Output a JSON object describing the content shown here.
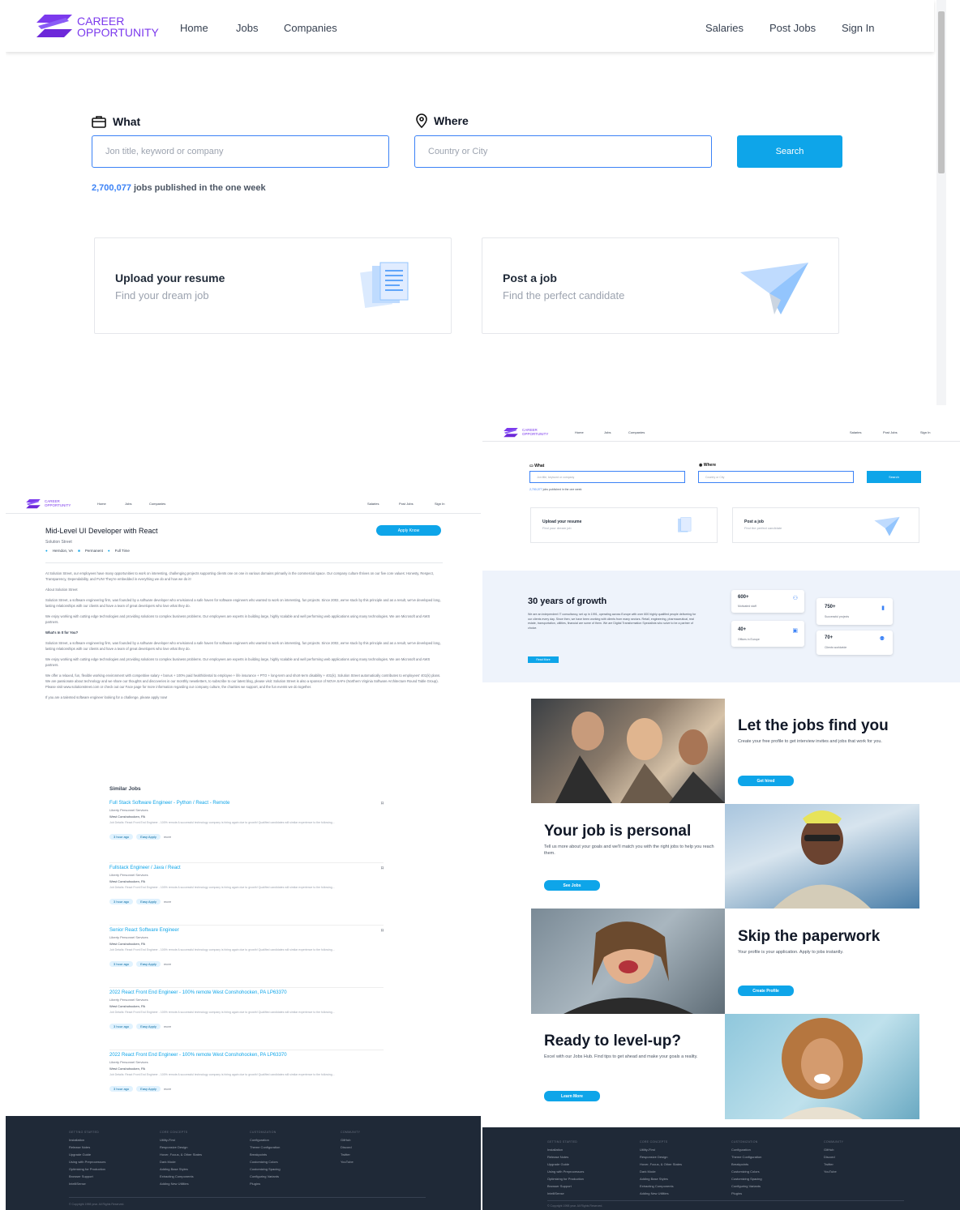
{
  "brand": {
    "line1": "CAREER",
    "line2": "OPPORTUNITY"
  },
  "nav": {
    "home": "Home",
    "jobs": "Jobs",
    "companies": "Companies",
    "salaries": "Salaries",
    "post_jobs": "Post Jobs",
    "sign_in": "Sign In"
  },
  "search": {
    "what_label": "What",
    "where_label": "Where",
    "what_placeholder": "Jon title, keyword or company",
    "where_placeholder": "Country or City",
    "button": "Search",
    "count": "2,700,077",
    "count_suffix": "jobs published in the one week"
  },
  "cards": {
    "upload_title": "Upload your resume",
    "upload_sub": "Find your dream job",
    "post_title": "Post a job",
    "post_sub": "Find the perfect candidate"
  },
  "job": {
    "title": "Mid-Level UI Developer with React",
    "company": "Solution Street",
    "location": "Herndon, VA",
    "type1": "Permanent",
    "type2": "Full Time",
    "apply": "Apply Know",
    "p1": "At Solution Street, our employees have many opportunities to work on interesting, challenging projects supporting clients one on one in various domains primarily in the commercial space. Our company culture thrives on our five core values: Honesty, Respect, Transparency, Dependability, and FUN! They're embedded in everything we do and how we do it!",
    "h1": "About Solution Street",
    "p2": "Solution Street, a software engineering firm, was founded by a software developer who envisioned a safe haven for software engineers who wanted to work on interesting, fun projects. Since 2002, we've stuck by this principle and as a result, we've developed long, lasting relationships with our clients and have a team of great developers who love what they do.",
    "p3": "We enjoy working with cutting edge technologies and providing solutions to complex business problems. Our employees are experts in building large, highly scalable and well performing web applications using many technologies. We are Microsoft and AWS partners.",
    "h2": "What's In It for You?",
    "p4": "Solution Street, a software engineering firm, was founded by a software developer who envisioned a safe haven for software engineers who wanted to work on interesting, fun projects. Since 2002, we've stuck by this principle and as a result, we've developed long, lasting relationships with our clients and have a team of great developers who love what they do.",
    "p5": "We enjoy working with cutting edge technologies and providing solutions to complex business problems. Our employees are experts in building large, highly scalable and well performing web applications using many technologies. We are Microsoft and AWS partners.",
    "p6": "We offer a relaxed, fun, flexible working environment with competitive salary + bonus + 100% paid health/dental to employee + life insurance + PTO + long-term and short-term disability + 401(k). Solution Street automatically contributes to employees' 401(k) plans. We are passionate about technology and we share our thoughts and discoveries in our monthly newsletters, to subscribe to our latest blog, please visit: Solution Street is also a sponsor of NOVA SAFe (Northern Virginia Software Architecture Round Table Group). Please visit www.solutionstreet.com or check out our Face page for more information regarding our company culture, the charities we support, and the fun events we do together.",
    "p7": "If you are a talented software engineer looking for a challenge, please apply now!"
  },
  "similar": {
    "heading": "Similar Jobs",
    "items": [
      {
        "title": "Full Stack Software Engineer - Python / React - Remote",
        "company": "Liberty Personnel Services",
        "location": "West Conshohocken, PA",
        "desc": "Job Details: React Front End Engineer - 100% remote A successful technology company is hiring again due to growth! Qualified candidates will similar experience to the following...",
        "time": "3 hour ago",
        "apply": "Easy Apply",
        "more": "more"
      },
      {
        "title": "Fullstack Engineer / Java / React",
        "company": "Liberty Personnel Services",
        "location": "West Conshohocken, PA",
        "desc": "Job Details: React Front End Engineer - 100% remote A successful technology company is hiring again due to growth! Qualified candidates will similar experience to the following...",
        "time": "3 hour ago",
        "apply": "Easy Apply",
        "more": "more"
      },
      {
        "title": "Senior React Software Engineer",
        "company": "Liberty Personnel Services",
        "location": "West Conshohocken, PA",
        "desc": "Job Details: React Front End Engineer - 100% remote A successful technology company is hiring again due to growth! Qualified candidates will similar experience to the following...",
        "time": "3 hour ago",
        "apply": "Easy Apply",
        "more": "more"
      },
      {
        "title": "2022 React Front End Engineer - 100% remote West Conshohocken, PA LP63370",
        "company": "Liberty Personnel Services",
        "location": "West Conshohocken, PA",
        "desc": "Job Details: React Front End Engineer - 100% remote A successful technology company is hiring again due to growth! Qualified candidates will similar experience to the following...",
        "time": "3 hour ago",
        "apply": "Easy Apply",
        "more": "more"
      },
      {
        "title": "2022 React Front End Engineer - 100% remote West Conshohocken, PA LP63370",
        "company": "Liberty Personnel Services",
        "location": "West Conshohocken, PA",
        "desc": "Job Details: React Front End Engineer - 100% remote A successful technology company is hiring again due to growth! Qualified candidates will similar experience to the following...",
        "time": "3 hour ago",
        "apply": "Easy Apply",
        "more": "more"
      }
    ]
  },
  "growth": {
    "title": "30 years of growth",
    "text": "We are an independent IT consultancy, set up in 1991, operating across Europe with over 600 highly qualified people delivering for our clients every day. Since then, we have been working with clients from many sectors. Retail, engineering, pharmaceutical, real estate, transportation, utilities, financial are some of them. We are Digital Transformation Specialists who solve to be a partner of choice.",
    "button": "Read More",
    "stats": [
      {
        "num": "600+",
        "label": "Motivated staff"
      },
      {
        "num": "750+",
        "label": "Successful projects"
      },
      {
        "num": "40+",
        "label": "Offices in Europe"
      },
      {
        "num": "70+",
        "label": "Clients worldwide"
      }
    ]
  },
  "features": [
    {
      "title": "Let the jobs find you",
      "text": "Create your free profile to get interview invites and jobs that work for you.",
      "button": "Get hired"
    },
    {
      "title": "Your job is personal",
      "text": "Tell us more about your goals and we'll match you with the right jobs to help you reach them.",
      "button": "See Jobs"
    },
    {
      "title": "Skip the paperwork",
      "text": "Your profile is your application. Apply to jobs instantly.",
      "button": "Create Profile"
    },
    {
      "title": "Ready to level-up?",
      "text": "Excel with our Jobs Hub. Find tips to get ahead and make your goals a reality.",
      "button": "Learn More"
    }
  ],
  "footer": {
    "cols": [
      {
        "head": "GETTING STARTED",
        "items": [
          "Installation",
          "Release Notes",
          "Upgrade Guide",
          "Using with Preprocessors",
          "Optimizing for Production",
          "Browser Support",
          "IntelliSense"
        ]
      },
      {
        "head": "CORE CONCEPTS",
        "items": [
          "Utility-First",
          "Responsive Design",
          "Hover, Focus, & Other States",
          "Dark Mode",
          "Adding Base Styles",
          "Extracting Components",
          "Adding New Utilities"
        ]
      },
      {
        "head": "CUSTOMIZATION",
        "items": [
          "Configuration",
          "Theme Configuration",
          "Breakpoints",
          "Customizing Colors",
          "Customizing Spacing",
          "Configuring Variants",
          "Plugins"
        ]
      },
      {
        "head": "COMMUNITY",
        "items": [
          "GitHub",
          "Discord",
          "Twitter",
          "YouTube"
        ]
      }
    ],
    "copyright": "© Copyright 1998 year. All Rights Reserved."
  },
  "colors": {
    "accent": "#0ea5e9",
    "brand": "#7c3aed",
    "footer": "#1f2937",
    "growth_bg": "#eef3fb"
  }
}
